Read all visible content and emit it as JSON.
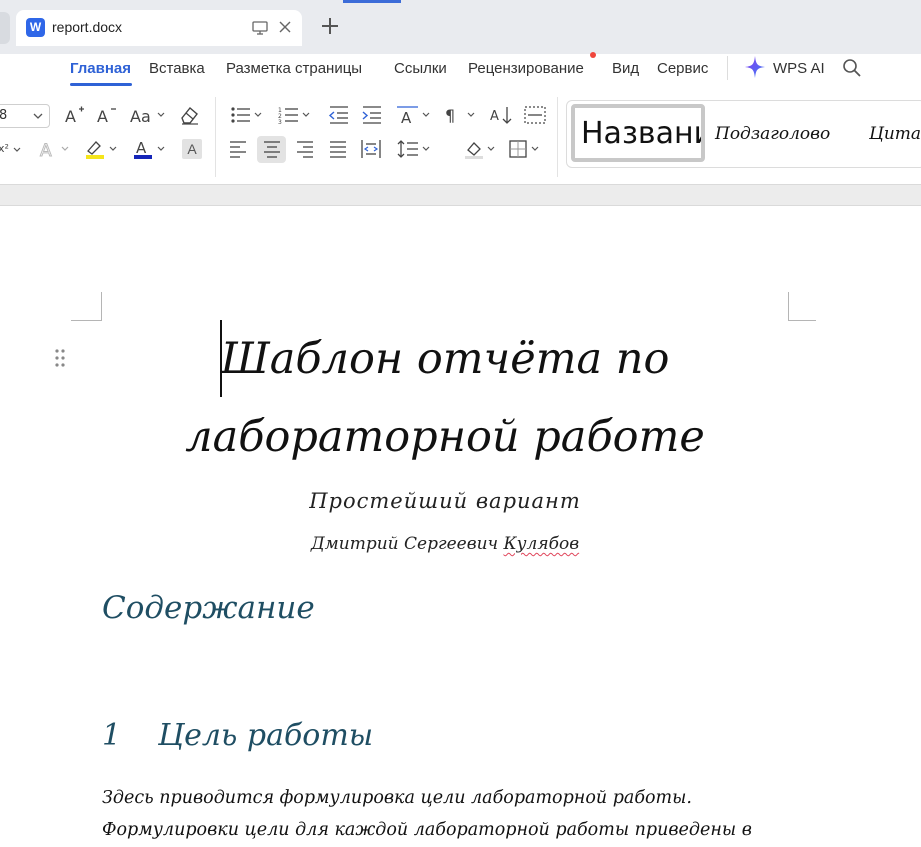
{
  "tabbar": {
    "app_icon_letter": "W",
    "tab_title": "report.docx"
  },
  "menu": {
    "items": [
      "Главная",
      "Вставка",
      "Разметка страницы",
      "Ссылки",
      "Рецензирование",
      "Вид",
      "Сервис"
    ],
    "active": "Главная",
    "ai_label": "WPS AI"
  },
  "toolbar": {
    "font_size": "8",
    "styles": [
      "Названи",
      "Подзаголово",
      "Цита"
    ],
    "selected_style": "Названи"
  },
  "document": {
    "title_line1": "Шаблон отчёта по",
    "title_line2": "лабораторной работе",
    "subtitle": "Простейший вариант",
    "author_prefix": "Дмитрий Сергеевич ",
    "author_surname": "Кулябов",
    "toc_heading": "Содержание",
    "section_number": "1",
    "section_title": "Цель работы",
    "body_line1": "Здесь приводится формулировка цели лабораторной работы.",
    "body_line2": "Формулировки цели для каждой лабораторной работы приведены в"
  },
  "colors": {
    "accent": "#2f62d6",
    "heading": "#1f4e63",
    "spellcheck": "#e0455b"
  }
}
